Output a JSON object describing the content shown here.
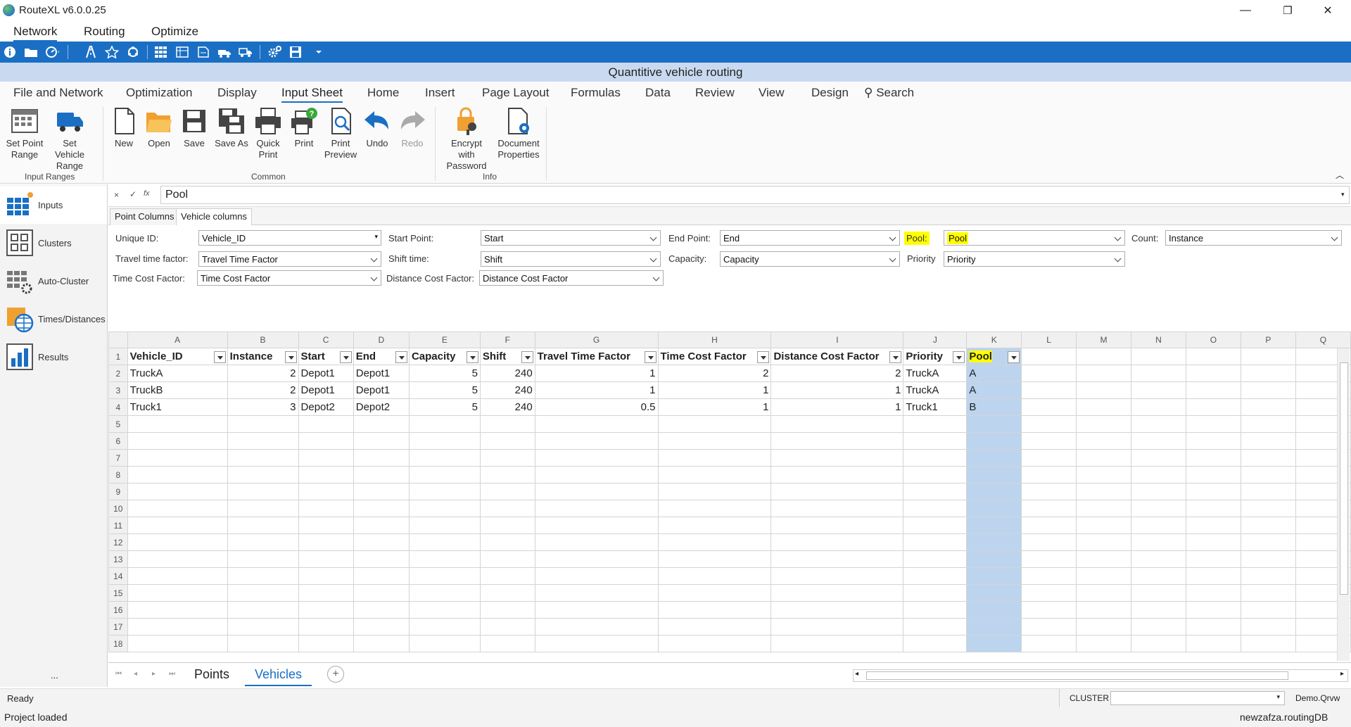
{
  "window": {
    "title": "RouteXL v6.0.0.25",
    "minimize": "—",
    "restore": "❐",
    "close": "✕"
  },
  "app_menu": [
    "Network",
    "Routing",
    "Optimize"
  ],
  "band_title": "Quantitive vehicle routing",
  "ribbon_tabs": [
    "File and Network",
    "Optimization",
    "Display",
    "Input Sheet",
    "Home",
    "Insert",
    "Page Layout",
    "Formulas",
    "Data",
    "Review",
    "View",
    "Design",
    "Search"
  ],
  "ribbon": {
    "set_point_range": "Set Point Range",
    "set_vehicle_range": "Set Vehicle Range",
    "group_input_ranges": "Input Ranges",
    "new": "New",
    "open": "Open",
    "save": "Save",
    "save_as": "Save As",
    "quick_print": "Quick Print",
    "print": "Print",
    "print_preview": "Print Preview",
    "undo": "Undo",
    "redo": "Redo",
    "group_common": "Common",
    "encrypt": "Encrypt with Password",
    "doc_props": "Document Properties",
    "group_info": "Info"
  },
  "left_nav": [
    "Inputs",
    "Clusters",
    "Auto-Cluster",
    "Times/Distances",
    "Results"
  ],
  "left_nav_more": "...",
  "formula": {
    "value": "Pool",
    "cancel": "×",
    "enter": "✓",
    "fx": "fx"
  },
  "config_tabs": [
    "Point Columns",
    "Vehicle columns"
  ],
  "config": {
    "unique_id_label": "Unique ID:",
    "unique_id": "Vehicle_ID",
    "start_point_label": "Start Point:",
    "start_point": "Start",
    "end_point_label": "End Point:",
    "end_point": "End",
    "pool_label": "Pool:",
    "pool": "Pool",
    "count_label": "Count:",
    "count": "Instance",
    "travel_time_label": "Travel time factor:",
    "travel_time": "Travel Time Factor",
    "shift_time_label": "Shift time:",
    "shift_time": "Shift",
    "capacity_label": "Capacity:",
    "capacity": "Capacity",
    "priority_label": "Priority",
    "priority": "Priority",
    "time_cost_label": "Time Cost Factor:",
    "time_cost": "Time Cost Factor",
    "distance_cost_label": "Distance Cost Factor:",
    "distance_cost": "Distance Cost Factor"
  },
  "sheet": {
    "columns": [
      "A",
      "B",
      "C",
      "D",
      "E",
      "F",
      "G",
      "H",
      "I",
      "J",
      "K",
      "L",
      "M",
      "N",
      "O",
      "P",
      "Q"
    ],
    "headers": [
      "Vehicle_ID",
      "Instance",
      "Start",
      "End",
      "Capacity",
      "Shift",
      "Travel Time Factor",
      "Time Cost Factor",
      "Distance Cost Factor",
      "Priority",
      "Pool"
    ],
    "rows": [
      [
        "TruckA",
        "2",
        "Depot1",
        "Depot1",
        "5",
        "240",
        "1",
        "2",
        "2",
        "TruckA",
        "A"
      ],
      [
        "TruckB",
        "2",
        "Depot1",
        "Depot1",
        "5",
        "240",
        "1",
        "1",
        "1",
        "TruckA",
        "A"
      ],
      [
        "Truck1",
        "3",
        "Depot2",
        "Depot2",
        "5",
        "240",
        "0.5",
        "1",
        "1",
        "Truck1",
        "B"
      ]
    ],
    "row_numbers": [
      "1",
      "2",
      "3",
      "4",
      "5",
      "6",
      "7",
      "8",
      "9",
      "10",
      "11",
      "12",
      "13",
      "14",
      "15",
      "16",
      "17",
      "18"
    ]
  },
  "sheet_tabs": [
    "Points",
    "Vehicles"
  ],
  "status": {
    "ready": "Ready",
    "cluster_label": "CLUSTER",
    "qrvw": "Demo.Qrvw",
    "loaded": "Project loaded",
    "db": "newzafza.routingDB"
  },
  "colors": {
    "accent": "#1a6fc4",
    "band": "#c9daf0",
    "highlight": "#ffff00",
    "selected_column": "#bcd4ee"
  }
}
